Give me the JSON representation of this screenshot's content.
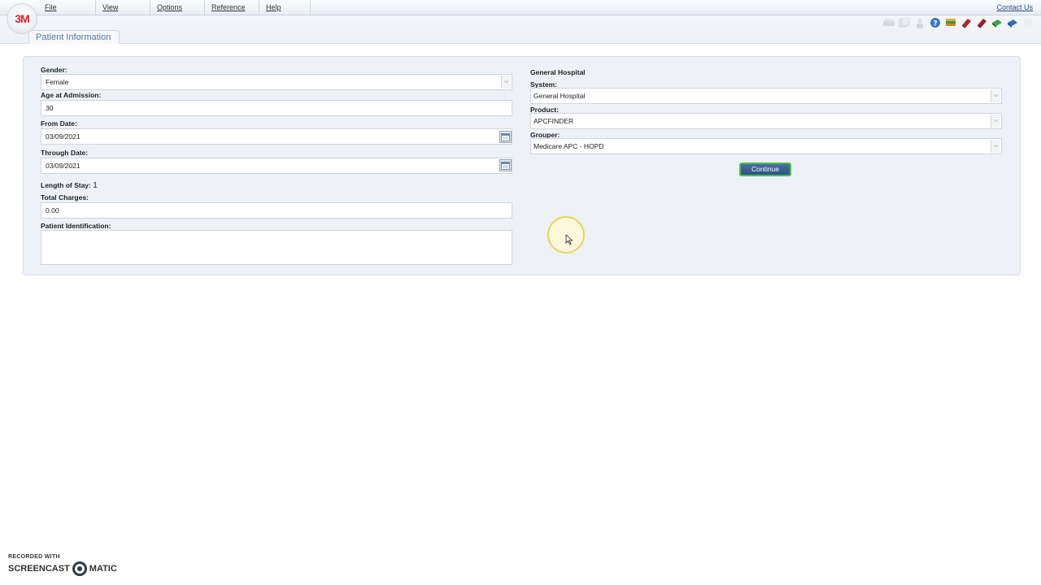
{
  "app": {
    "logo_text": "3M"
  },
  "menu": {
    "items": [
      "File",
      "View",
      "Options",
      "Reference",
      "Help"
    ],
    "contact_label": "Contact Us"
  },
  "tab": {
    "label": "Patient Information"
  },
  "toolbar": {
    "icons": [
      "print-icon",
      "copy-icon",
      "user-icon",
      "help-icon",
      "stack-books-icon",
      "red-book-icon",
      "red-book-2-icon",
      "green-book-icon",
      "blue-book-icon"
    ]
  },
  "form": {
    "gender_label": "Gender:",
    "gender_value": "Female",
    "age_label": "Age at Admission:",
    "age_value": "30",
    "from_label": "From Date:",
    "from_value": "03/09/2021",
    "through_label": "Through Date:",
    "through_value": "03/09/2021",
    "los_label": "Length of Stay:",
    "los_value": "1",
    "charges_label": "Total Charges:",
    "charges_value": "0.00",
    "pid_label": "Patient Identification:",
    "pid_value": ""
  },
  "right": {
    "heading": "General Hospital",
    "system_label": "System:",
    "system_value": "General Hospital",
    "product_label": "Product:",
    "product_value": "APCFINDER",
    "grouper_label": "Grouper:",
    "grouper_value": "Medicare APC - HOPD",
    "continue_label": "Continue"
  },
  "watermark": {
    "line1": "RECORDED WITH",
    "line2a": "SCREENCAST",
    "line2b": "MATIC"
  },
  "colors": {
    "accent": "#2f5286",
    "brand": "#e01e24",
    "focus": "#45c145",
    "panel": "#eef1f7"
  }
}
